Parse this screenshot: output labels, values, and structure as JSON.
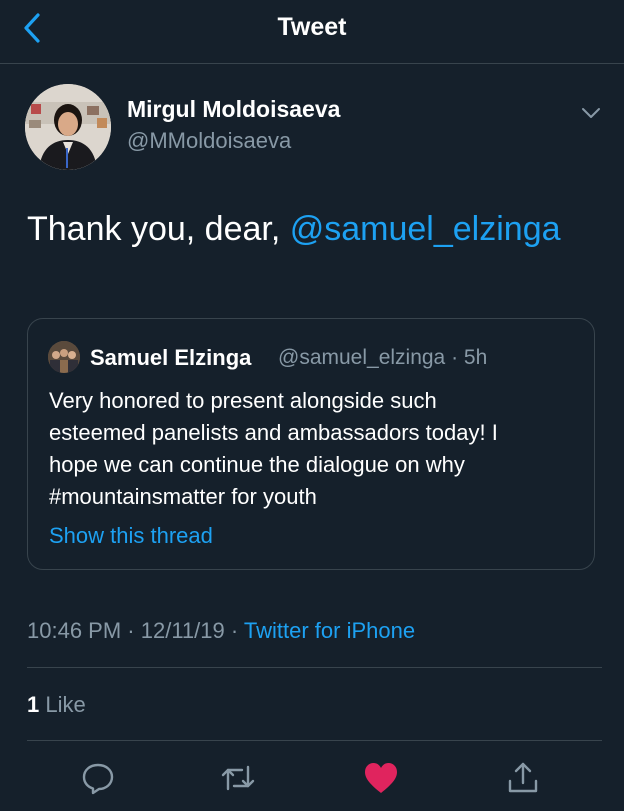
{
  "header": {
    "title": "Tweet",
    "back_icon": "chevron-left-icon"
  },
  "author": {
    "name": "Mirgul Moldoisaeva",
    "handle": "@MMoldoisaeva",
    "menu_icon": "chevron-down-icon"
  },
  "tweet": {
    "text": "Thank you, dear, ",
    "mention": "@samuel_elzinga"
  },
  "quoted_tweet": {
    "name": "Samuel Elzinga",
    "meta": "@samuel_elzinga · 5h",
    "lines": [
      "Very honored to present alongside such",
      "esteemed panelists and ambassadors today! I",
      "hope we can continue the dialogue on why",
      "#mountainsmatter for youth"
    ],
    "show_thread": "Show this thread"
  },
  "details": {
    "time": "10:46 PM",
    "separator1": " · ",
    "date": "12/11/19",
    "separator2": " · ",
    "source": "Twitter for iPhone"
  },
  "engagement": {
    "like_count": "1",
    "like_label": " Like"
  },
  "actions": [
    {
      "icon": "reply-icon"
    },
    {
      "icon": "retweet-icon"
    },
    {
      "icon": "heart-icon",
      "liked": true
    },
    {
      "icon": "share-icon"
    }
  ],
  "colors": {
    "background": "#15202b",
    "accent": "#1da1f2",
    "secondary_text": "#8899a6",
    "divider": "#38444d",
    "like": "#e0245e"
  }
}
